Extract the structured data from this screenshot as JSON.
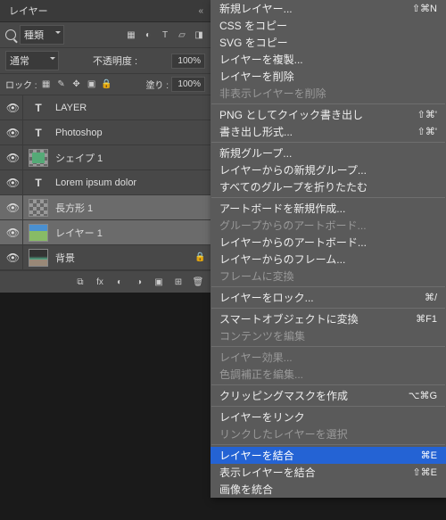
{
  "panel": {
    "title": "レイヤー",
    "filter_kind": "種類",
    "blend_mode": "通常",
    "opacity_label": "不透明度 :",
    "opacity_val": "100%",
    "lock_label": "ロック :",
    "fill_label": "塗り :",
    "fill_val": "100%",
    "layers": [
      {
        "name": "LAYER"
      },
      {
        "name": "Photoshop"
      },
      {
        "name": "シェイプ 1"
      },
      {
        "name": "Lorem ipsum dolor"
      },
      {
        "name": "長方形 1"
      },
      {
        "name": "レイヤー 1"
      },
      {
        "name": "背景"
      }
    ]
  },
  "menu": {
    "items": [
      {
        "label": "新規レイヤー...",
        "shortcut": "⇧⌘N"
      },
      {
        "label": "CSS をコピー"
      },
      {
        "label": "SVG をコピー"
      },
      {
        "label": "レイヤーを複製..."
      },
      {
        "label": "レイヤーを削除"
      },
      {
        "label": "非表示レイヤーを削除",
        "disabled": true
      },
      {
        "sep": true
      },
      {
        "label": "PNG としてクイック書き出し",
        "shortcut": "⇧⌘'"
      },
      {
        "label": "書き出し形式...",
        "shortcut": "⇧⌘'"
      },
      {
        "sep": true
      },
      {
        "label": "新規グループ..."
      },
      {
        "label": "レイヤーからの新規グループ..."
      },
      {
        "label": "すべてのグループを折りたたむ"
      },
      {
        "sep": true
      },
      {
        "label": "アートボードを新規作成..."
      },
      {
        "label": "グループからのアートボード...",
        "disabled": true
      },
      {
        "label": "レイヤーからのアートボード..."
      },
      {
        "label": "レイヤーからのフレーム..."
      },
      {
        "label": "フレームに変換",
        "disabled": true
      },
      {
        "sep": true
      },
      {
        "label": "レイヤーをロック...",
        "shortcut": "⌘/"
      },
      {
        "sep": true
      },
      {
        "label": "スマートオブジェクトに変換",
        "shortcut": "⌘F1"
      },
      {
        "label": "コンテンツを編集",
        "disabled": true
      },
      {
        "sep": true
      },
      {
        "label": "レイヤー効果...",
        "disabled": true
      },
      {
        "label": "色調補正を編集...",
        "disabled": true
      },
      {
        "sep": true
      },
      {
        "label": "クリッピングマスクを作成",
        "shortcut": "⌥⌘G"
      },
      {
        "sep": true
      },
      {
        "label": "レイヤーをリンク"
      },
      {
        "label": "リンクしたレイヤーを選択",
        "disabled": true
      },
      {
        "sep": true
      },
      {
        "label": "レイヤーを結合",
        "shortcut": "⌘E",
        "highlight": true
      },
      {
        "label": "表示レイヤーを結合",
        "shortcut": "⇧⌘E"
      },
      {
        "label": "画像を統合"
      }
    ]
  }
}
